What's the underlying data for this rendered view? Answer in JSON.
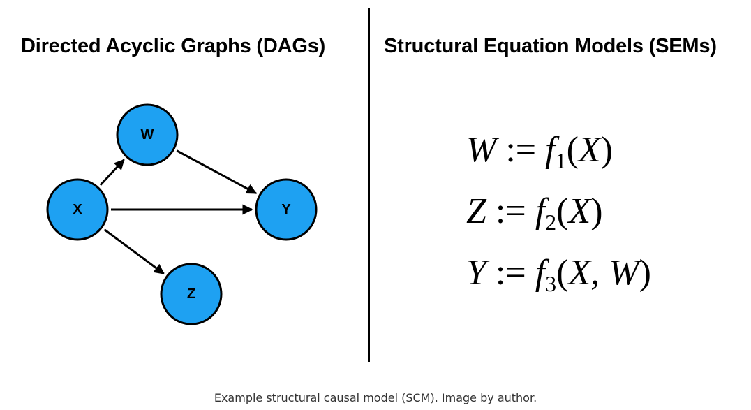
{
  "left_title": "Directed Acyclic Graphs (DAGs)",
  "right_title": "Structural Equation Models (SEMs)",
  "dag": {
    "node_color": "#1ea1f2",
    "nodes": [
      {
        "id": "W",
        "label": "W"
      },
      {
        "id": "X",
        "label": "X"
      },
      {
        "id": "Y",
        "label": "Y"
      },
      {
        "id": "Z",
        "label": "Z"
      }
    ],
    "edges": [
      {
        "from": "X",
        "to": "W"
      },
      {
        "from": "W",
        "to": "Y"
      },
      {
        "from": "X",
        "to": "Y"
      },
      {
        "from": "X",
        "to": "Z"
      }
    ]
  },
  "equations": [
    {
      "lhs": "W",
      "assign": ":=",
      "func": "f",
      "sub": "1",
      "open": "(",
      "args": "X",
      "close": ")"
    },
    {
      "lhs": "Z",
      "assign": ":=",
      "func": "f",
      "sub": "2",
      "open": "(",
      "args": "X",
      "close": ")"
    },
    {
      "lhs": "Y",
      "assign": ":=",
      "func": "f",
      "sub": "3",
      "open": "(",
      "args": "X, W",
      "close": ")"
    }
  ],
  "caption": "Example structural causal model (SCM). Image by author."
}
